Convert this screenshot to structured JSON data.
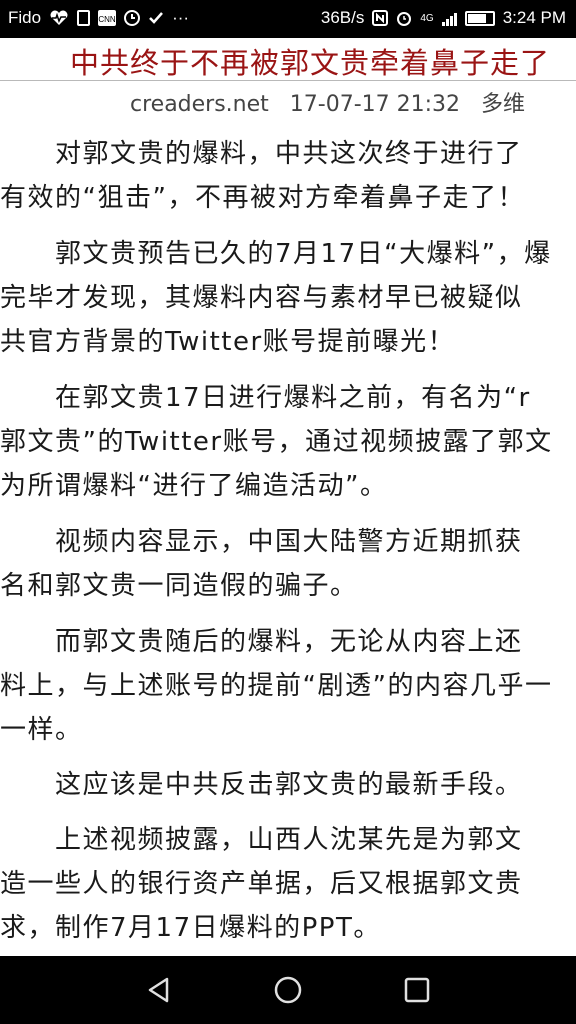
{
  "status_bar": {
    "carrier": "Fido",
    "more": "···",
    "net_speed": "36B/s",
    "network_type": "4G",
    "time": "3:24 PM",
    "left_icons": [
      "heartbeat-icon",
      "notification-icon",
      "cnn-icon",
      "clock-icon",
      "checkmark-icon"
    ],
    "right_icons": [
      "nfc-icon",
      "alarm-icon",
      "signal-icon",
      "battery-icon"
    ]
  },
  "article": {
    "title": "中共终于不再被郭文贵牵着鼻子走了",
    "source": "creaders.net",
    "datetime": "17-07-17 21:32",
    "author": "多维",
    "lines": [
      "　　对郭文贵的爆料，中共这次终于进行了",
      "有效的“狙击”，不再被对方牵着鼻子走了！",
      "　　郭文贵预告已久的7月17日“大爆料”，爆",
      "完毕才发现，其爆料内容与素材早已被疑似",
      "共官方背景的Twitter账号提前曝光！",
      "　　在郭文贵17日进行爆料之前，有名为“r",
      "郭文贵”的Twitter账号，通过视频披露了郭文",
      "为所谓爆料“进行了编造活动”。",
      "　　视频内容显示，中国大陆警方近期抓获",
      "名和郭文贵一同造假的骗子。",
      "　　而郭文贵随后的爆料，无论从内容上还",
      "料上，与上述账号的提前“剧透”的内容几乎一",
      "一样。",
      "　　这应该是中共反击郭文贵的最新手段。",
      "　　上述视频披露，山西人沈某先是为郭文",
      "造一些人的银行资产单据，后又根据郭文贵",
      "求，制作7月17日爆料的PPT。"
    ]
  },
  "nav_bar": {
    "buttons": [
      "back-icon",
      "home-icon",
      "recents-icon"
    ]
  }
}
